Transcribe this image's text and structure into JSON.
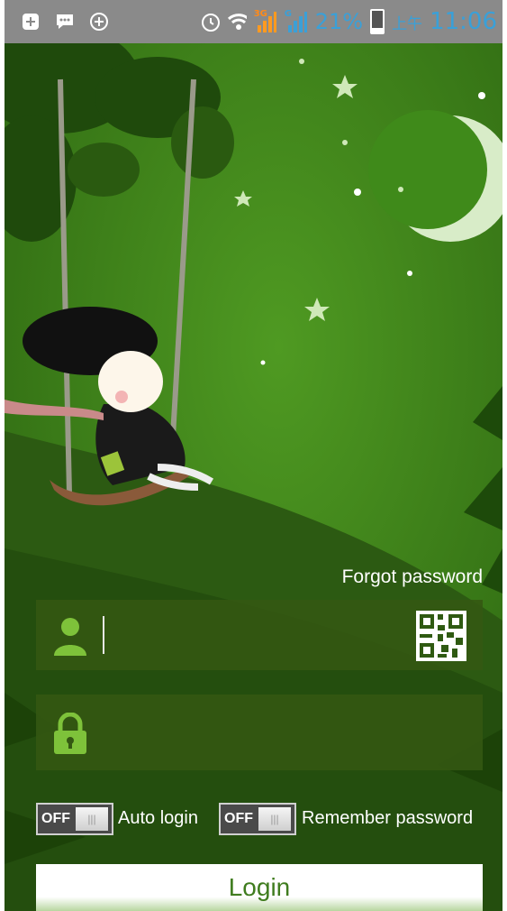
{
  "status_bar": {
    "network_3g": "3G",
    "network_g": "G",
    "battery_pct": "21%",
    "ampm": "上午",
    "time": "11:06",
    "accent": "#3aa0d8"
  },
  "form": {
    "forgot_label": "Forgot password",
    "username_value": "",
    "password_value": "",
    "auto_login": {
      "state": "OFF",
      "label": "Auto login"
    },
    "remember_password": {
      "state": "OFF",
      "label": "Remember password"
    },
    "login_label": "Login"
  },
  "colors": {
    "background": "#2f6a12",
    "field_bg": "#345812",
    "icon_green": "#7ec23a",
    "login_text": "#3f7c1e"
  }
}
